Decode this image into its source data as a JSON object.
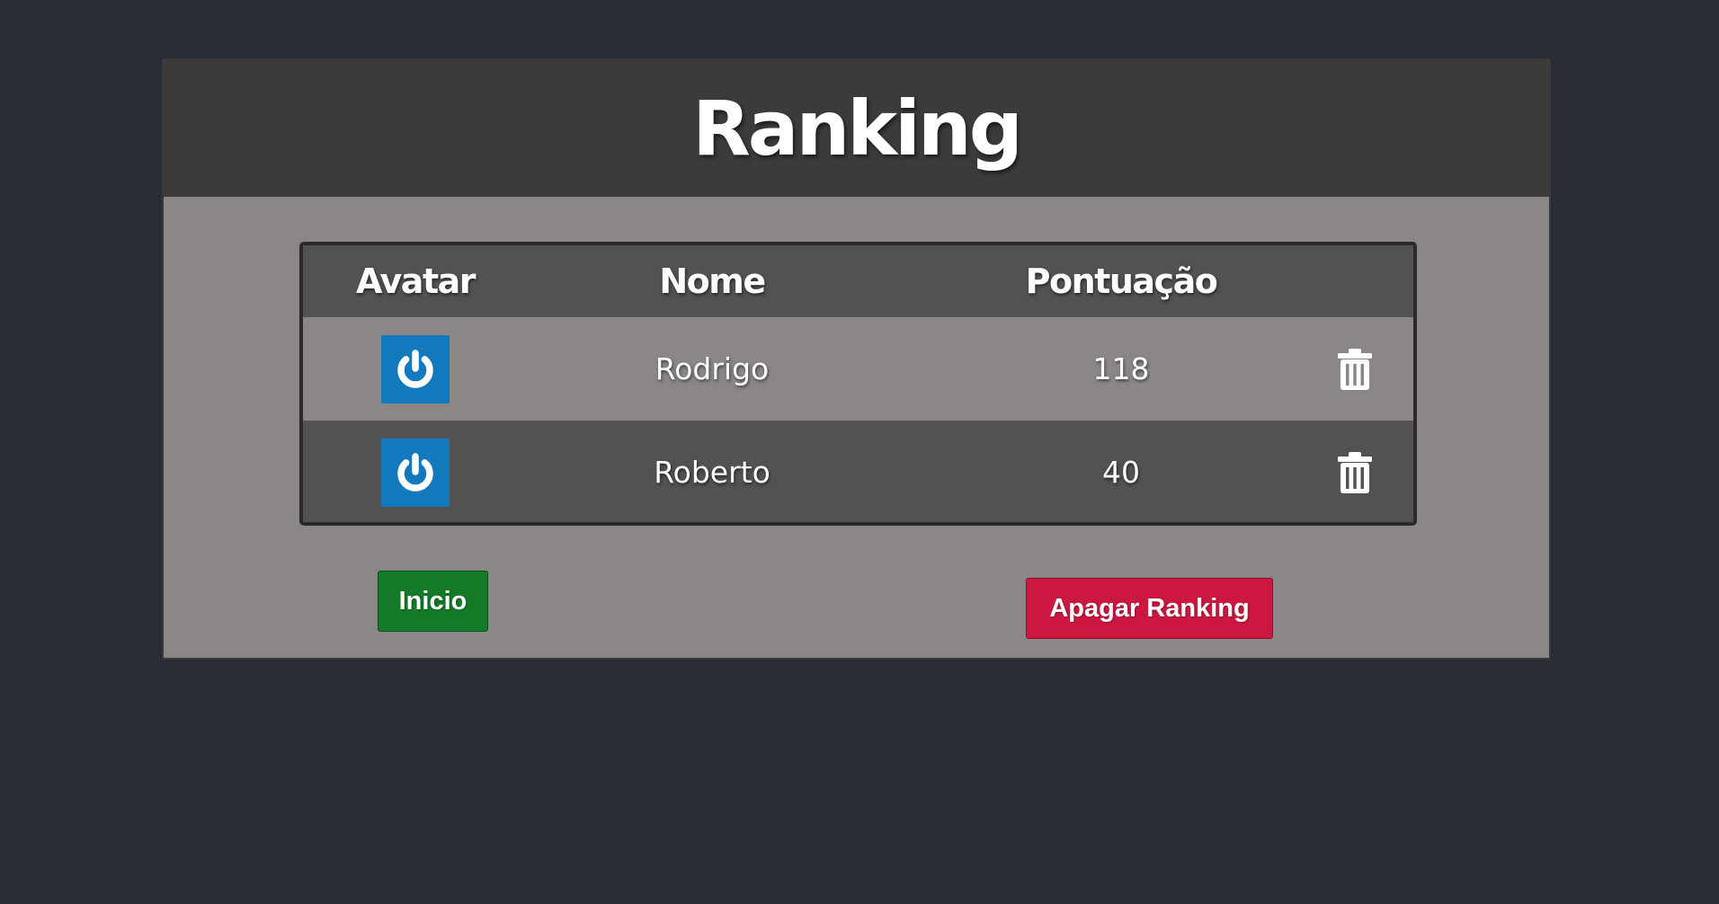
{
  "page": {
    "title": "Ranking"
  },
  "table": {
    "headers": {
      "avatar": "Avatar",
      "nome": "Nome",
      "pontuacao": "Pontuação",
      "actions": ""
    },
    "rows": [
      {
        "avatar_icon": "power-icon",
        "nome": "Rodrigo",
        "pontuacao": "118",
        "delete_icon": "trash-icon"
      },
      {
        "avatar_icon": "power-icon",
        "nome": "Roberto",
        "pontuacao": "40",
        "delete_icon": "trash-icon"
      }
    ]
  },
  "actions": {
    "inicio_label": "Inicio",
    "apagar_label": "Apagar Ranking"
  },
  "colors": {
    "background": "#282c35",
    "panel": "#8b8786",
    "panel_header": "#3d3b3a",
    "table_dark": "#535151",
    "avatar_blue": "#1379bd",
    "inicio_green": "#137a27",
    "apagar_red": "#cc1741"
  }
}
